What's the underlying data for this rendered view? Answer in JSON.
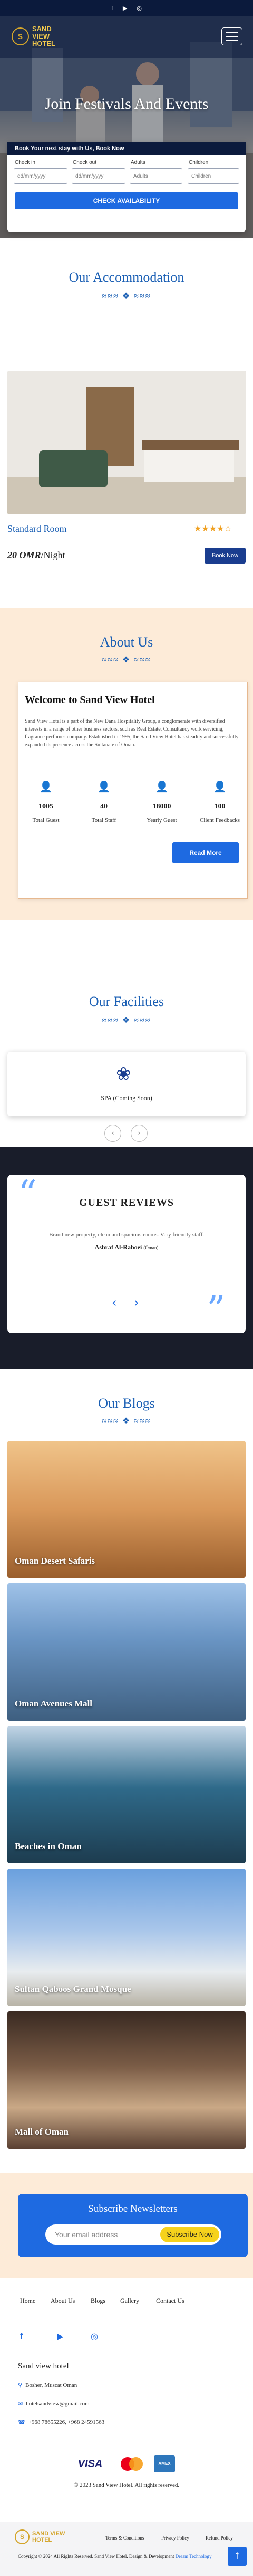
{
  "topbar": {
    "icons": [
      "facebook-icon",
      "youtube-icon",
      "instagram-icon"
    ],
    "glyphs": [
      "f",
      "▶",
      "◎"
    ]
  },
  "header": {
    "logo_mark": "S",
    "logo_line1": "SAND VIEW",
    "logo_line2": "HOTEL"
  },
  "hero": {
    "title": "Join Festivals And Events"
  },
  "booking": {
    "heading": "Book Your next stay with Us, Book Now",
    "checkin_label": "Check in",
    "checkin_placeholder": "dd/mm/yyyy",
    "checkout_label": "Check out",
    "checkout_placeholder": "dd/mm/yyyy",
    "adults_label": "Adults",
    "adults_value": "Adults",
    "children_label": "Children",
    "children_value": "Children",
    "button": "CHECK AVAILABILITY"
  },
  "accommodation": {
    "title": "Our Accommodation",
    "room_name": "Standard Room",
    "stars": "★★★★☆",
    "price": "20 OMR",
    "price_unit": "/Night",
    "book_button": "Book Now"
  },
  "about": {
    "title": "About Us",
    "heading": "Welcome to Sand View Hotel",
    "text": "Sand View Hotel is a part of the New Dana Hospitality Group, a conglomerate with diversified interests in a range of other business sectors, such as Real Estate, Consultancy work servicing, fragrance perfumes company. Established in 1995, the Sand View Hotel has steadily and successfully expanded its presence across the Sultanate of Oman.",
    "stats": [
      {
        "value": "1005",
        "label": "Total Guest"
      },
      {
        "value": "40",
        "label": "Total Staff"
      },
      {
        "value": "18000",
        "label": "Yearly Guest"
      },
      {
        "value": "100",
        "label": "Client Feedbacks"
      }
    ],
    "read_more": "Read More"
  },
  "facilities": {
    "title": "Our Facilities",
    "item": "SPA (Coming Soon)",
    "prev": "‹",
    "next": "›"
  },
  "reviews": {
    "title": "GUEST REVIEWS",
    "text": "Brand new property, clean and spacious rooms. Very friendly staff.",
    "name": "Ashraf Al-Raboei",
    "country": "(Oman)",
    "prev": "‹",
    "next": "›"
  },
  "blogs": {
    "title": "Our Blogs",
    "items": [
      {
        "label": "Oman Desert Safaris",
        "color": "#c98a4a"
      },
      {
        "label": "Oman Avenues Mall",
        "color": "#4a7fb8"
      },
      {
        "label": "Beaches in Oman",
        "color": "#2f5d7a"
      },
      {
        "label": "Sultan Qaboos Grand Mosque",
        "color": "#7a9cc8"
      },
      {
        "label": "Mall of Oman",
        "color": "#6b4a36"
      }
    ]
  },
  "newsletter": {
    "title": "Subscribe Newsletters",
    "placeholder": "Your email address",
    "button": "Subscribe Now"
  },
  "footer": {
    "nav": [
      "Home",
      "About Us",
      "Blogs",
      "Gallery",
      "Contact Us"
    ],
    "hotel_name": "Sand view hotel",
    "address": "Bosher, Muscat Oman",
    "email": "hotelsandview@gmail.com",
    "phone": "+968 78655226, +968 24591563",
    "payment": [
      "VISA",
      "Mastercard",
      "AMEX"
    ],
    "copyright_top": "© 2023 Sand View Hotel. All rights reserved.",
    "links": [
      "Terms & Conditions",
      "Privacy Policy",
      "Refund Policy"
    ],
    "copyright_bottom": "Copyright © 2024 All Rights Reserved. Sand View Hotel. Design & Development",
    "developer": "Dream Technology",
    "to_top": "↑"
  }
}
